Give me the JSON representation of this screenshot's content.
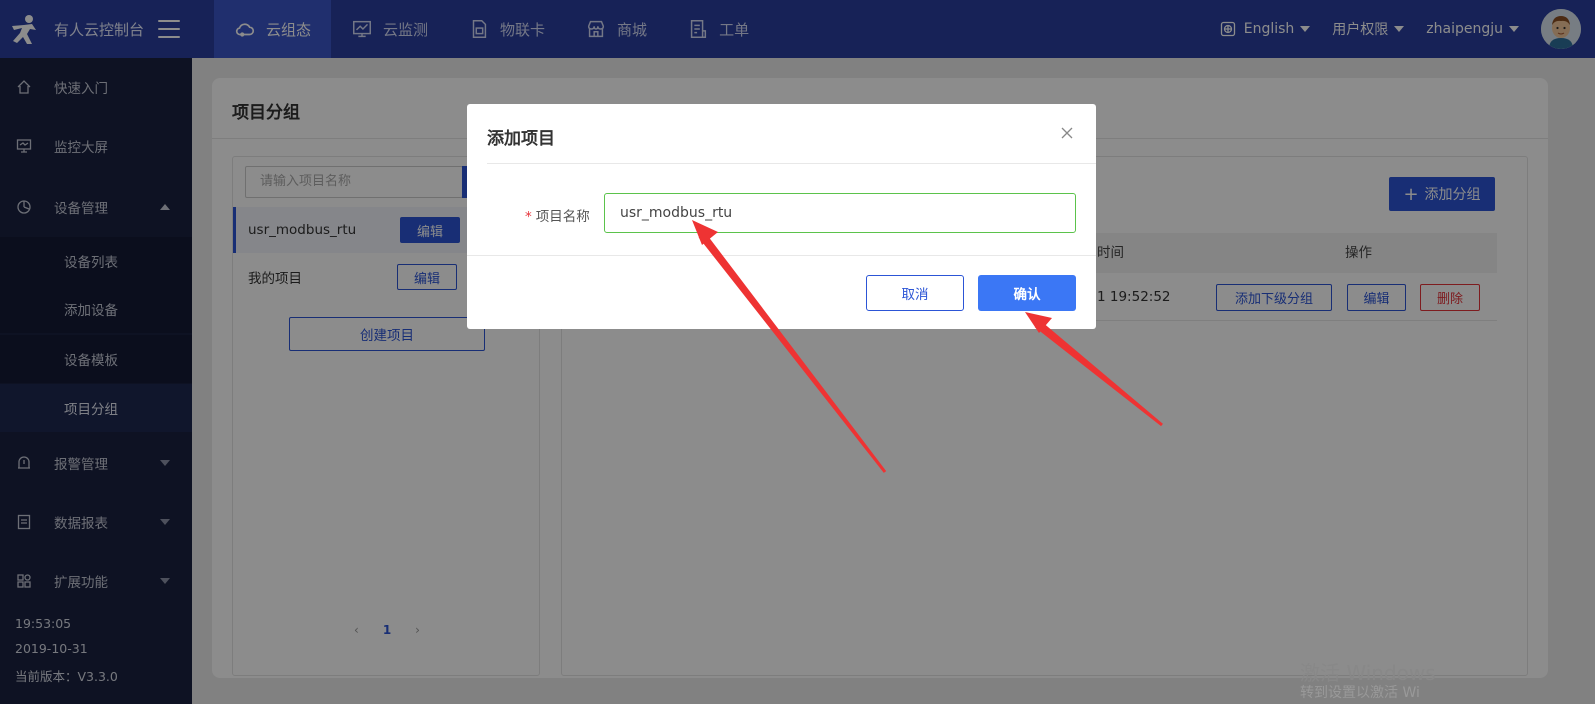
{
  "header": {
    "app_title": "有人云控制台",
    "nav": [
      {
        "label": "云组态",
        "icon": "cloud-icon",
        "active": true
      },
      {
        "label": "云监测",
        "icon": "chart-monitor-icon",
        "active": false
      },
      {
        "label": "物联卡",
        "icon": "sim-card-icon",
        "active": false
      },
      {
        "label": "商城",
        "icon": "store-icon",
        "active": false
      },
      {
        "label": "工单",
        "icon": "ticket-icon",
        "active": false
      }
    ],
    "language": "English",
    "permissions": "用户权限",
    "username": "zhaipengju"
  },
  "sidebar": {
    "items": [
      {
        "label": "快速入门",
        "icon": "home-icon"
      },
      {
        "label": "监控大屏",
        "icon": "monitor-icon"
      },
      {
        "label": "设备管理",
        "icon": "device-icon"
      },
      {
        "label": "报警管理",
        "icon": "alarm-icon"
      },
      {
        "label": "数据报表",
        "icon": "report-icon"
      },
      {
        "label": "扩展功能",
        "icon": "extension-icon"
      }
    ],
    "subitems": [
      {
        "label": "设备列表"
      },
      {
        "label": "添加设备"
      },
      {
        "label": "设备模板"
      },
      {
        "label": "项目分组"
      }
    ],
    "time": "19:53:05",
    "date": "2019-10-31",
    "version": "当前版本：V3.3.0"
  },
  "page": {
    "title": "项目分组",
    "search_placeholder": "请输入项目名称",
    "projects": [
      {
        "name": "usr_modbus_rtu",
        "edit": "编辑"
      },
      {
        "name": "我的项目",
        "edit": "编辑"
      }
    ],
    "create_project": "创建项目",
    "page_current": "1",
    "add_group": "添加分组",
    "table_headers": {
      "time": "时间",
      "actions": "操作"
    },
    "row": {
      "time": "1 19:52:52",
      "add_sub": "添加下级分组",
      "edit": "编辑",
      "delete": "删除"
    },
    "watermark": "激活 Windows",
    "watermark_sub": "转到设置以激活 Wi"
  },
  "modal": {
    "title": "添加项目",
    "field_label": "项目名称",
    "field_value": "usr_modbus_rtu",
    "cancel": "取消",
    "confirm": "确认"
  },
  "colors": {
    "header_bg": "#2a3f9e",
    "sidebar_bg": "#1a2240",
    "primary": "#2c55d6",
    "confirm": "#3b77f5",
    "danger": "#e5333a",
    "input_valid_border": "#5bc34b",
    "annotation_arrow": "#ee3333"
  }
}
